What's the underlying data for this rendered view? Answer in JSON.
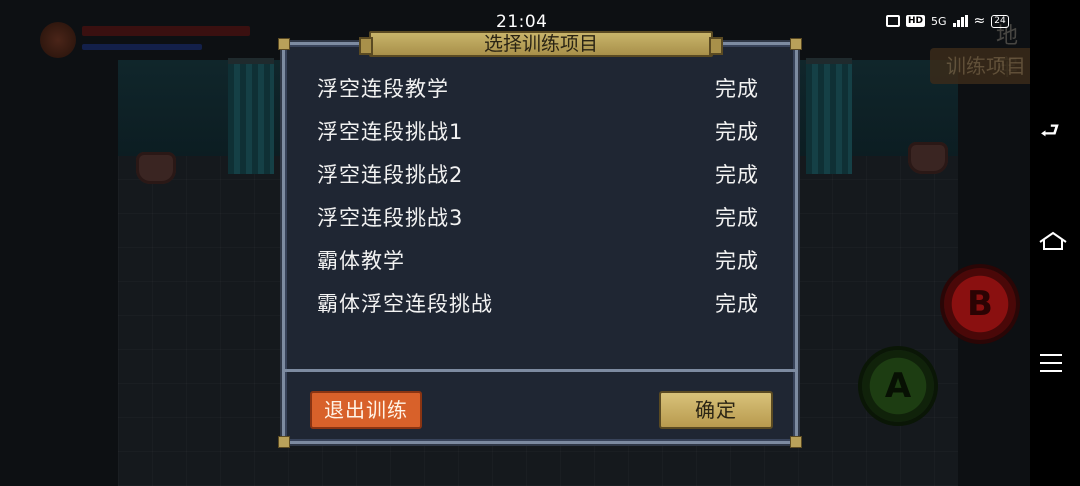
{
  "status_bar": {
    "time": "21:04",
    "network": "5G",
    "hd_label": "HD",
    "battery": "24"
  },
  "game": {
    "location": "地牢",
    "training_button": "训练项目",
    "btn_b_label": "B",
    "btn_a_label": "A"
  },
  "dialog": {
    "title": "选择训练项目",
    "items": [
      {
        "name": "浮空连段教学",
        "status": "完成"
      },
      {
        "name": "浮空连段挑战1",
        "status": "完成"
      },
      {
        "name": "浮空连段挑战2",
        "status": "完成"
      },
      {
        "name": "浮空连段挑战3",
        "status": "完成"
      },
      {
        "name": "霸体教学",
        "status": "完成"
      },
      {
        "name": "霸体浮空连段挑战",
        "status": "完成"
      }
    ],
    "exit_label": "退出训练",
    "confirm_label": "确定"
  },
  "colors": {
    "dialog_bg": "#1f2633",
    "dialog_border": "#7d8ba1",
    "exit_button": "#d8612a",
    "confirm_button": "#c8b46a"
  },
  "icons": {
    "back": "back-icon",
    "home": "home-icon",
    "menu": "menu-icon"
  }
}
